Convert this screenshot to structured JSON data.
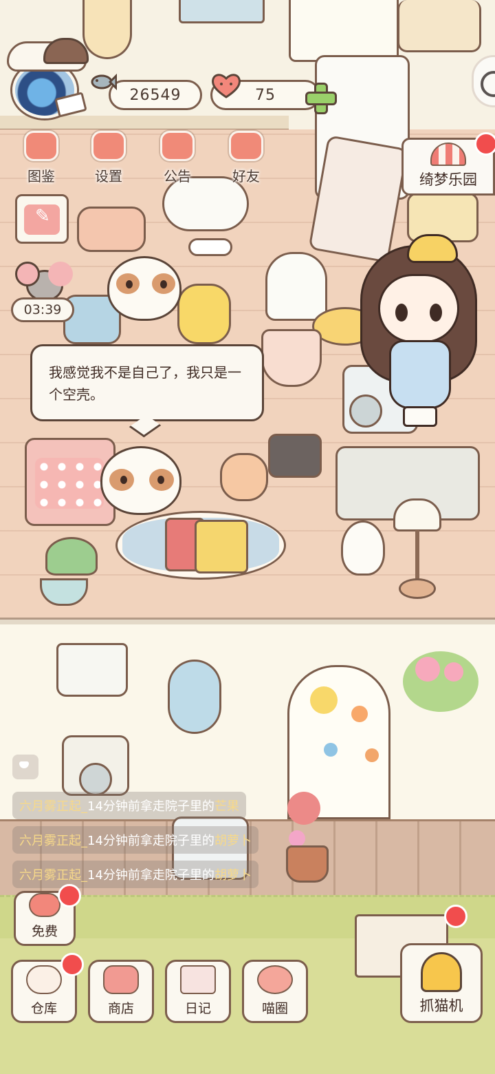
{
  "resources": {
    "coins": "26549",
    "hearts": "75"
  },
  "top_menu": [
    {
      "label": "图鉴",
      "icon": "cat-book-icon"
    },
    {
      "label": "设置",
      "icon": "gear-icon"
    },
    {
      "label": "公告",
      "icon": "gift-icon"
    },
    {
      "label": "好友",
      "icon": "friends-icon"
    }
  ],
  "event": {
    "label": "绮梦乐园",
    "icon": "carnival-tent-icon"
  },
  "timer": "03:39",
  "speech": "我感觉我不是自己了，我只是一个空壳。",
  "feed": [
    {
      "user": "六月雾正起_",
      "action": "14分钟前拿走院子里的",
      "item": "芒果"
    },
    {
      "user": "六月雾正起_",
      "action": "14分钟前拿走院子里的",
      "item": "胡萝卜"
    },
    {
      "user": "六月雾正起_",
      "action": "14分钟前拿走院子里的",
      "item": "胡萝卜"
    }
  ],
  "free_button": {
    "label": "免费"
  },
  "bottom_nav": [
    {
      "label": "仓库",
      "icon": "warehouse-icon",
      "color": "#fbf0e6"
    },
    {
      "label": "商店",
      "icon": "shop-icon",
      "color": "#f19a92"
    },
    {
      "label": "日记",
      "icon": "diary-icon",
      "color": "#f7e3e0"
    },
    {
      "label": "喵圈",
      "icon": "cat-planet-icon",
      "color": "#f4a69a"
    }
  ],
  "claw_machine": {
    "label": "抓猫机"
  },
  "colors": {
    "accent_red": "#f14d4d",
    "ui_border": "#7b5d4c",
    "floor": "#f1d3bd",
    "grass": "#d9dd98"
  }
}
